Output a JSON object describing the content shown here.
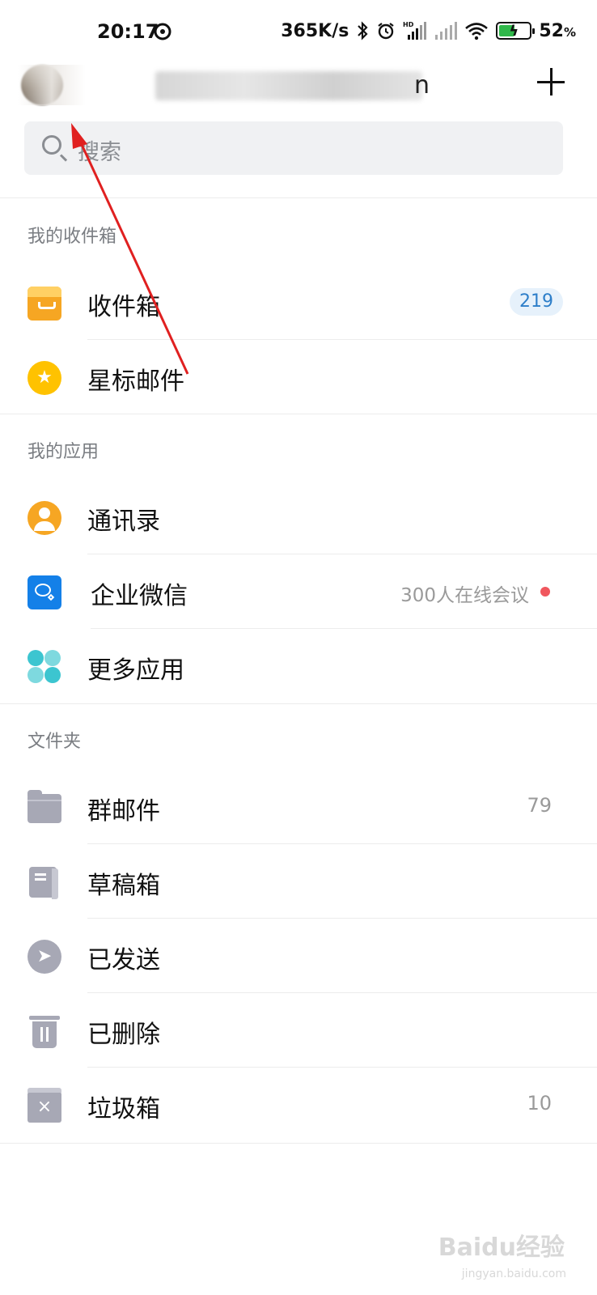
{
  "status_bar": {
    "time": "20:17",
    "speed": "365K/s",
    "hd": "HD",
    "battery": "52",
    "battery_unit": "%",
    "battery_level": 0.52
  },
  "header": {
    "account_tail": "n"
  },
  "search": {
    "placeholder": "搜索"
  },
  "sections": {
    "inbox": "我的收件箱",
    "apps": "我的应用",
    "folders": "文件夹"
  },
  "inbox_items": [
    {
      "label": "收件箱",
      "count": "219",
      "icon": "inbox-icon"
    },
    {
      "label": "星标邮件",
      "icon": "star-icon"
    }
  ],
  "app_items": [
    {
      "label": "通讯录",
      "icon": "contacts-icon"
    },
    {
      "label": "企业微信",
      "hint": "300人在线会议",
      "icon": "wework-icon"
    },
    {
      "label": "更多应用",
      "icon": "more-apps-icon"
    }
  ],
  "folder_items": [
    {
      "label": "群邮件",
      "count": "79",
      "icon": "folder-icon"
    },
    {
      "label": "草稿箱",
      "icon": "draft-icon"
    },
    {
      "label": "已发送",
      "icon": "sent-icon"
    },
    {
      "label": "已删除",
      "icon": "trash-icon"
    },
    {
      "label": "垃圾箱",
      "count": "10",
      "icon": "spam-icon"
    }
  ],
  "watermark": {
    "brand": "Baidu经验",
    "url": "jingyan.baidu.com"
  },
  "colors": {
    "badge_bg": "#e6f1fb",
    "badge_text": "#2d7ec9",
    "arrow": "#e02020",
    "folder_icon": "#a7a8b5"
  }
}
